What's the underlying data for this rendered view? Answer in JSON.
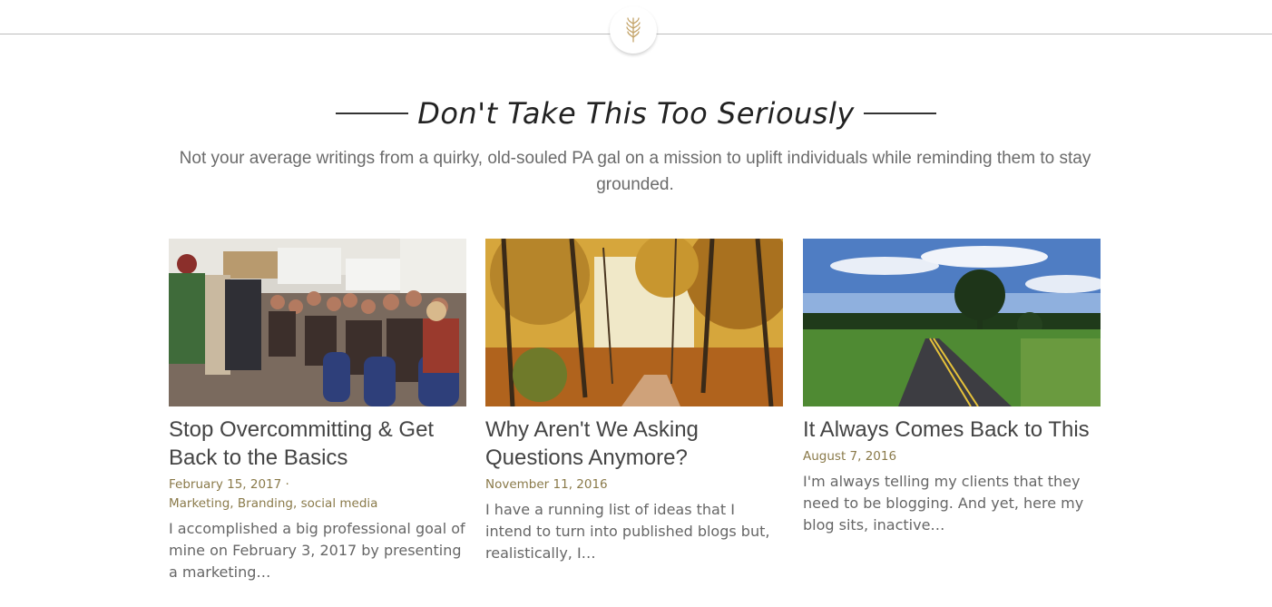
{
  "header": {
    "logo_icon": "wheat-icon",
    "accent_color": "#c4a46a"
  },
  "intro": {
    "title": "Don't Take This Too Seriously",
    "tagline": "Not your average writings from a quirky, old-souled PA gal on a mission to uplift individuals while reminding them to stay grounded."
  },
  "posts": [
    {
      "title": "Stop Overcommitting & Get Back to the Basics",
      "date": "February 15, 2017 ·",
      "tags": [
        "Marketing",
        "Branding",
        "social media"
      ],
      "excerpt": "I accomplished a big professional goal of mine on February 3, 2017 by presenting a marketing…"
    },
    {
      "title": "Why Aren't We Asking Questions Anymore?",
      "date": "November 11, 2016",
      "excerpt": "I have a running list of ideas that I intend to turn into published blogs but, realistically, I…"
    },
    {
      "title": "It Always Comes Back to This",
      "date": "August 7, 2016",
      "excerpt": "I'm always telling my clients that they need to be blogging. And yet, here my blog sits, inactive…"
    }
  ]
}
